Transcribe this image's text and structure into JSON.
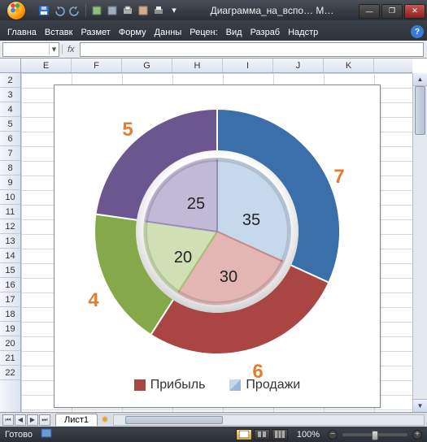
{
  "window": {
    "title": "Диаграмма_на_вспо… M…"
  },
  "ribbon": {
    "tabs": [
      "Главна",
      "Вставк",
      "Размет",
      "Форму",
      "Данны",
      "Рецен:",
      "Вид",
      "Разраб",
      "Надстр"
    ]
  },
  "formula": {
    "fx": "fx",
    "name_value": "",
    "formula_value": ""
  },
  "grid": {
    "columns": [
      "E",
      "F",
      "G",
      "H",
      "I",
      "J",
      "K"
    ],
    "rows": [
      "2",
      "3",
      "4",
      "5",
      "6",
      "7",
      "8",
      "9",
      "10",
      "11",
      "12",
      "13",
      "14",
      "15",
      "16",
      "17",
      "18",
      "19",
      "20",
      "21",
      "22"
    ]
  },
  "sheet": {
    "name": "Лист1"
  },
  "status": {
    "ready": "Готово",
    "zoom": "100%"
  },
  "legend": {
    "profit": "Прибыль",
    "sales": "Продажи"
  },
  "colors": {
    "outer_blue": "#3b6fa9",
    "outer_red": "#a94643",
    "outer_green": "#85a94a",
    "outer_purple": "#6c568f",
    "inner_blue": "#c6d8ec",
    "inner_red": "#e3b5b3",
    "inner_green": "#d0e0b4",
    "inner_purple": "#c2b9d7",
    "label_orange": "#e57d2f"
  },
  "chart_data": {
    "type": "pie",
    "series": [
      {
        "name": "Прибыль",
        "ring": "outer",
        "values": [
          7,
          6,
          4,
          5
        ],
        "colors": [
          "#3b6fa9",
          "#a94643",
          "#85a94a",
          "#6c568f"
        ]
      },
      {
        "name": "Продажи",
        "ring": "inner",
        "values": [
          35,
          30,
          20,
          25
        ],
        "colors": [
          "#c6d8ec",
          "#e3b5b3",
          "#d0e0b4",
          "#c2b9d7"
        ]
      }
    ],
    "outer_labels": {
      "v7": "7",
      "v6": "6",
      "v4": "4",
      "v5": "5"
    },
    "inner_labels": {
      "v35": "35",
      "v30": "30",
      "v20": "20",
      "v25": "25"
    }
  }
}
